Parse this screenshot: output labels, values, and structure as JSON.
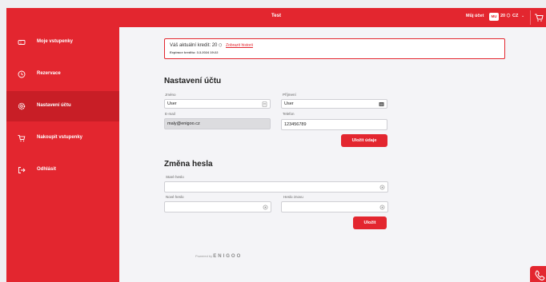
{
  "header": {
    "title": "Test",
    "account_label": "Můj účet",
    "user_initials": "MU",
    "credit": "20",
    "language": "CZ"
  },
  "sidebar": {
    "items": [
      {
        "label": "Moje vstupenky",
        "icon": "ticket-icon"
      },
      {
        "label": "Rezervace",
        "icon": "clock-icon"
      },
      {
        "label": "Nastavení účtu",
        "icon": "gear-icon",
        "active": true
      },
      {
        "label": "Nakoupit vstupenky",
        "icon": "cart-icon"
      },
      {
        "label": "Odhlásit",
        "icon": "logout-icon"
      }
    ]
  },
  "credit": {
    "text": "Váš aktuální kredit: 20",
    "history_link": "Zobrazit historii",
    "expiry": "Expirace kreditu: 3.3.2024 19:22"
  },
  "account": {
    "title": "Nastavení účtu",
    "first_name_label": "Jméno",
    "first_name_value": "User",
    "last_name_label": "Příjmení",
    "last_name_value": "User",
    "email_label": "E-mail",
    "email_value": "maly@enigoo.cz",
    "phone_label": "Telefon",
    "phone_value": "123456789",
    "save_button": "Uložit údaje"
  },
  "password": {
    "title": "Změna hesla",
    "old_label": "Staré heslo",
    "new_label": "Nové heslo",
    "repeat_label": "Heslo znovu",
    "save_button": "Uložit"
  },
  "footer": {
    "powered_by": "Powered by",
    "brand": "ENIGOO"
  },
  "colors": {
    "accent": "#e3262f",
    "accent_dark": "#c81e26"
  }
}
